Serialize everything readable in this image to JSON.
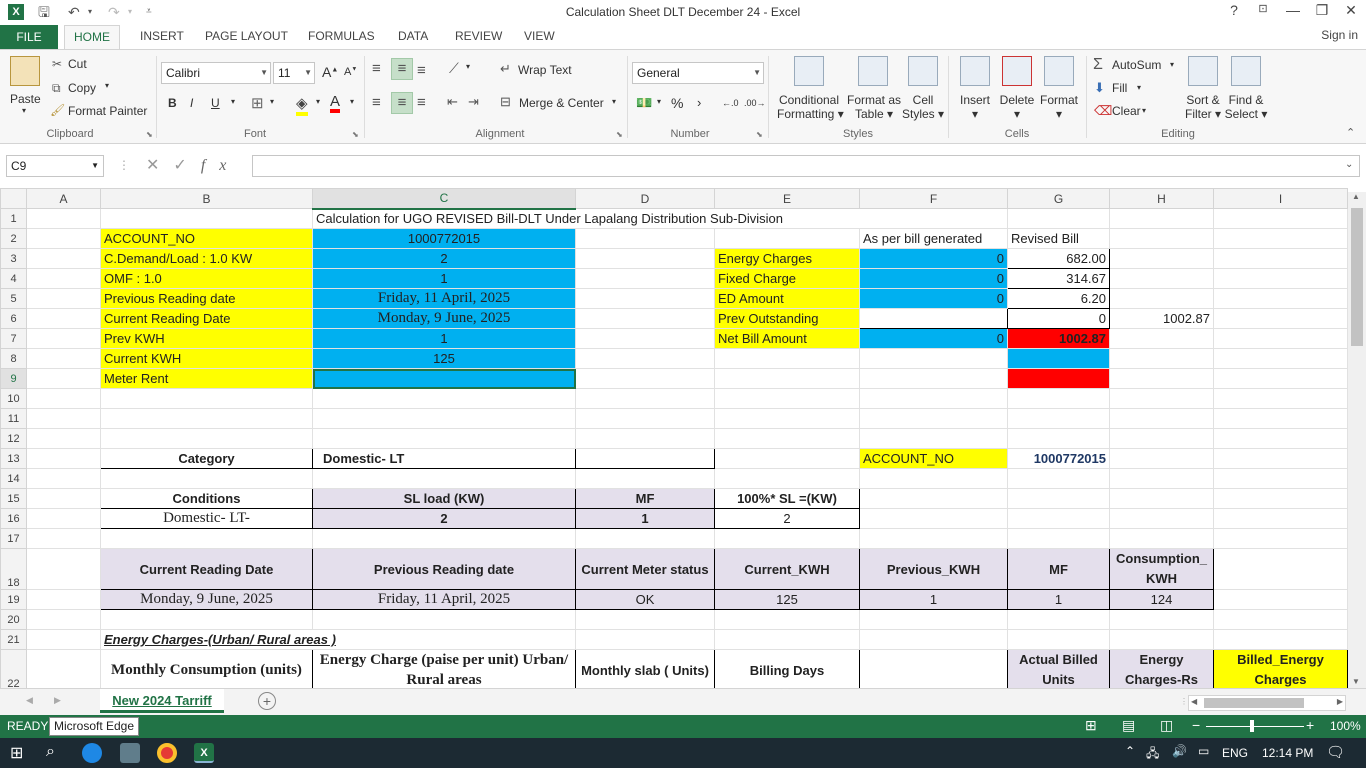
{
  "window": {
    "title": "Calculation Sheet DLT December 24 - Excel",
    "help": "?",
    "controls": [
      "—",
      "❐",
      "✕"
    ]
  },
  "ribbon_tabs": [
    "FILE",
    "HOME",
    "INSERT",
    "PAGE LAYOUT",
    "FORMULAS",
    "DATA",
    "REVIEW",
    "VIEW"
  ],
  "signin": "Sign in",
  "clipboard": {
    "paste": "Paste",
    "cut": "Cut",
    "copy": "Copy",
    "format_painter": "Format Painter",
    "label": "Clipboard"
  },
  "font": {
    "name": "Calibri",
    "size": "11",
    "bold": "B",
    "italic": "I",
    "underline": "U",
    "label": "Font"
  },
  "alignment": {
    "wrap": "Wrap Text",
    "merge": "Merge & Center",
    "label": "Alignment"
  },
  "number": {
    "format": "General",
    "percent": "%",
    "comma": "›",
    "label": "Number"
  },
  "styles": {
    "conditional": [
      "Conditional",
      "Formatting"
    ],
    "format_table": [
      "Format as",
      "Table"
    ],
    "cell_styles": [
      "Cell",
      "Styles"
    ],
    "label": "Styles"
  },
  "cells": {
    "insert": "Insert",
    "delete": "Delete",
    "format": "Format",
    "label": "Cells"
  },
  "editing": {
    "autosum": "AutoSum",
    "fill": "Fill",
    "clear": "Clear",
    "sort": [
      "Sort &",
      "Filter"
    ],
    "find": [
      "Find &",
      "Select"
    ],
    "label": "Editing"
  },
  "formula_bar": {
    "name_box": "C9",
    "fx": "fx",
    "formula": ""
  },
  "columns": [
    "A",
    "B",
    "C",
    "D",
    "E",
    "F",
    "G",
    "H",
    "I"
  ],
  "sheet": {
    "title": "Calculation for UGO REVISED Bill-DLT Under Lapalang Distribution Sub-Division",
    "r2": {
      "b": "ACCOUNT_NO",
      "c": "1000772015",
      "f": "As per bill generated",
      "g": "Revised Bill"
    },
    "r3": {
      "b": "C.Demand/Load : 1.0 KW",
      "c": "2",
      "e": "Energy Charges",
      "f": "0",
      "g": "682.00"
    },
    "r4": {
      "b": "OMF : 1.0",
      "c": "1",
      "e": "Fixed Charge",
      "f": "0",
      "g": "314.67"
    },
    "r5": {
      "b": "Previous Reading date",
      "c": "Friday, 11 April, 2025",
      "e": "ED Amount",
      "f": "0",
      "g": "6.20"
    },
    "r6": {
      "b": "Current Reading Date",
      "c": "Monday, 9 June, 2025",
      "e": "Prev Outstanding",
      "g": "0",
      "h": "1002.87"
    },
    "r7": {
      "b": "Prev KWH",
      "c": "1",
      "e": "Net Bill Amount",
      "f": "0",
      "g": "1002.87"
    },
    "r8": {
      "b": "Current KWH",
      "c": "125"
    },
    "r9": {
      "b": "Meter Rent"
    },
    "r13": {
      "b": "Category",
      "c": "Domestic- LT",
      "f": "ACCOUNT_NO",
      "g": "1000772015"
    },
    "r15": {
      "b": "Conditions",
      "c": "SL load (KW)",
      "d": "MF",
      "e": "100%* SL =(KW)"
    },
    "r16": {
      "b": "Domestic- LT-",
      "c": "2",
      "d": "1",
      "e": "2"
    },
    "r18": {
      "b": "Current Reading Date",
      "c": "Previous Reading date",
      "d": "Current Meter status",
      "e": "Current_KWH",
      "f": "Previous_KWH",
      "g": "MF",
      "h": "Consumption_KWH"
    },
    "r19": {
      "b": "Monday, 9 June, 2025",
      "c": "Friday, 11 April, 2025",
      "d": "OK",
      "e": "125",
      "f": "1",
      "g": "1",
      "h": "124"
    },
    "r21": {
      "b": "Energy Charges-(Urban/ Rural areas )"
    },
    "r22": {
      "b": "Monthly Consumption (units)",
      "c": "Energy Charge (paise per unit)  Urban/ Rural areas",
      "d": "Monthly slab ( Units)",
      "e": "Billing Days",
      "g": "Actual Billed Units",
      "h": "Energy Charges-Rs",
      "i": "Billed_Energy Charges"
    }
  },
  "sheet_tab": "New 2024 Tarriff",
  "status": {
    "ready": "READY",
    "tooltip": "Microsoft Edge",
    "zoom": "100%"
  },
  "taskbar": {
    "lang": "ENG",
    "time": "12:14 PM"
  },
  "colors": {
    "excel_green": "#217346",
    "yellow": "#ffff00",
    "blue": "#00b0f0",
    "red": "#ff0000",
    "lavender": "#e4dfec"
  }
}
